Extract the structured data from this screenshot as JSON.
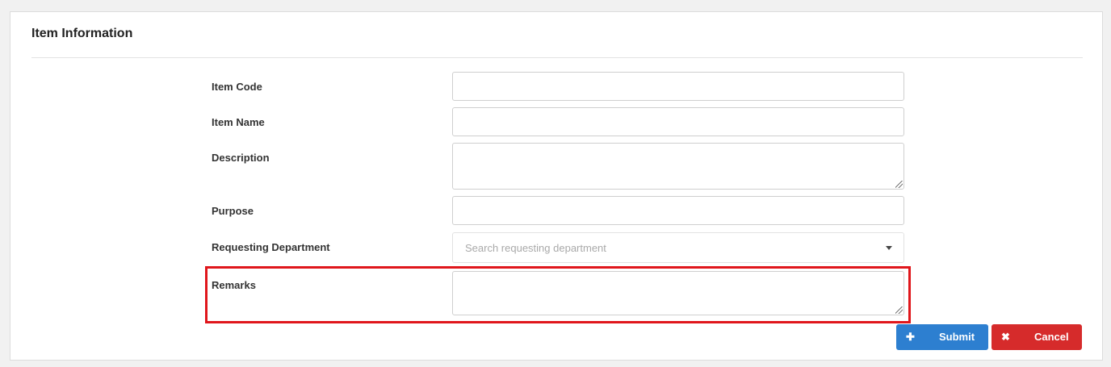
{
  "panel": {
    "title": "Item Information"
  },
  "form": {
    "item_code": {
      "label": "Item Code",
      "value": ""
    },
    "item_name": {
      "label": "Item Name",
      "value": ""
    },
    "description": {
      "label": "Description",
      "value": ""
    },
    "purpose": {
      "label": "Purpose",
      "value": ""
    },
    "requesting_department": {
      "label": "Requesting Department",
      "placeholder": "Search requesting department"
    },
    "remarks": {
      "label": "Remarks",
      "value": ""
    }
  },
  "actions": {
    "submit_label": "Submit",
    "submit_icon": "plus-icon",
    "cancel_label": "Cancel",
    "cancel_icon": "close-icon"
  },
  "colors": {
    "submit": "#2d7fd0",
    "cancel": "#d62b2b",
    "highlight": "#e0161b"
  }
}
